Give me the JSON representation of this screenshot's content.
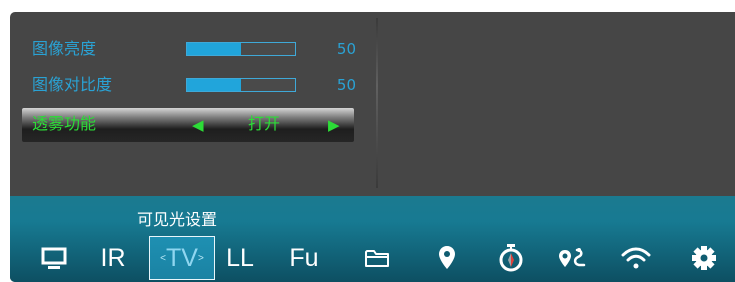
{
  "menu": {
    "items": [
      {
        "label": "图像亮度",
        "value": "50",
        "level": 0.5
      },
      {
        "label": "图像对比度",
        "value": "50",
        "level": 0.5
      },
      {
        "label": "透雾功能",
        "option": "打开",
        "left_arrow": "◀",
        "right_arrow": "▶"
      }
    ]
  },
  "bottom_bar": {
    "title": "可见光设置",
    "tabs": [
      {
        "icon": "monitor-icon"
      },
      {
        "label": "IR"
      },
      {
        "label": "TV",
        "left_mark": "<",
        "right_mark": ">",
        "selected": true
      },
      {
        "label": "LL"
      },
      {
        "label": "Fu"
      }
    ],
    "icons": [
      "folder-icon",
      "location-pin-icon",
      "stopwatch-icon",
      "route-icon",
      "wifi-icon",
      "gear-icon"
    ]
  },
  "colors": {
    "menu_text": "#2aa2d4",
    "slider_fill": "#21a5db",
    "active_text": "#2cdc37",
    "bar_top": "#1b7a90",
    "panel_bg": "#464646"
  }
}
